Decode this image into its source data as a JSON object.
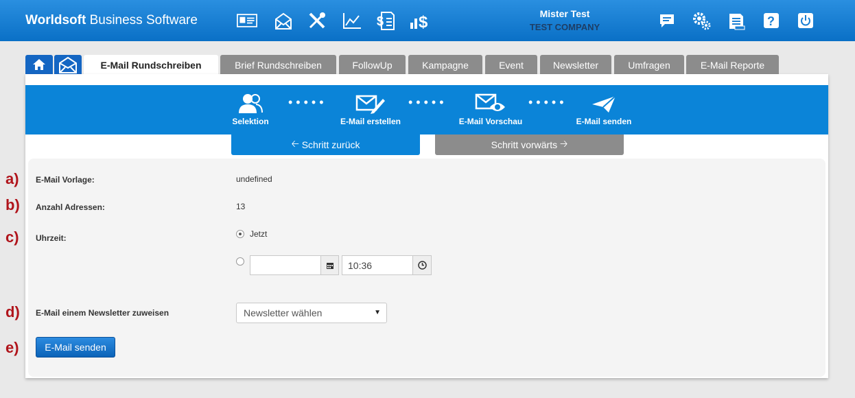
{
  "header": {
    "brand_bold": "Worldsoft",
    "brand_rest": " Business Software",
    "user_name": "Mister Test",
    "company": "TEST COMPANY",
    "icons": [
      "contacts-card-icon",
      "email-campaign-icon",
      "tools-icon",
      "line-chart-icon",
      "invoice-dollar-icon",
      "revenue-dollar-icon",
      "messages-icon",
      "settings-gears-icon",
      "print-document-icon",
      "help-icon",
      "logout-power-icon"
    ]
  },
  "tabs": {
    "items": [
      {
        "label": "E-Mail Rundschreiben"
      },
      {
        "label": "Brief Rundschreiben"
      },
      {
        "label": "FollowUp"
      },
      {
        "label": "Kampagne"
      },
      {
        "label": "Event"
      },
      {
        "label": "Newsletter"
      },
      {
        "label": "Umfragen"
      },
      {
        "label": "E-Mail Reporte"
      }
    ]
  },
  "wizard": {
    "steps": [
      {
        "label": "Selektion"
      },
      {
        "label": "E-Mail erstellen"
      },
      {
        "label": "E-Mail Vorschau"
      },
      {
        "label": "E-Mail senden"
      }
    ],
    "back_label": "Schritt zurück",
    "forward_label": "Schritt vorwärts"
  },
  "form": {
    "template_label": "E-Mail Vorlage:",
    "template_value": "undefined",
    "count_label": "Anzahl Adressen:",
    "count_value": "13",
    "time_label": "Uhrzeit:",
    "now_label": "Jetzt",
    "date_value": "",
    "time_value": "10:36",
    "newsletter_label": "E-Mail einem Newsletter zuweisen",
    "newsletter_select": "Newsletter wählen",
    "send_button": "E-Mail senden"
  },
  "markers": [
    "a)",
    "b)",
    "c)",
    "d)",
    "e)"
  ],
  "colors": {
    "primary": "#0b84d8",
    "header": "#1a7fd4",
    "tab_inactive": "#8c8c8c",
    "marker": "#b0141b"
  }
}
